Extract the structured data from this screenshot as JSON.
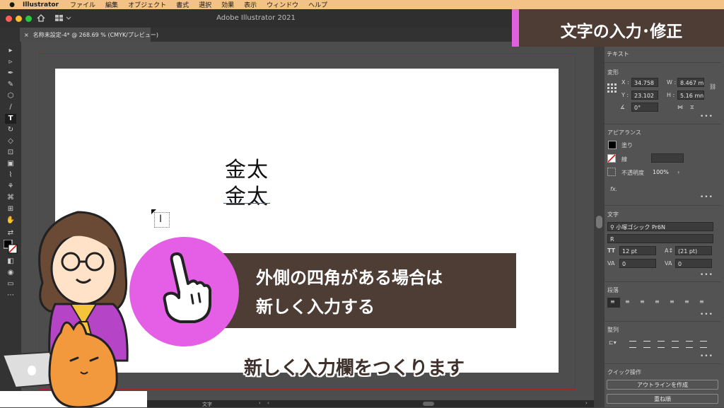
{
  "menubar": {
    "app_name": "Illustrator",
    "items": [
      "ファイル",
      "編集",
      "オブジェクト",
      "書式",
      "選択",
      "効果",
      "表示",
      "ウィンドウ",
      "ヘルプ"
    ]
  },
  "window": {
    "title": "Adobe Illustrator 2021"
  },
  "document_tab": {
    "label": "名称未設定-4* @ 268.69 % (CMYK/プレビュー)",
    "close": "×"
  },
  "artboard": {
    "line1": "金太",
    "line2": "金太"
  },
  "title_banner": {
    "text": "文字の入力･修正",
    "accent_color": "#e060e0",
    "bg_color": "#4d3d35"
  },
  "callout": {
    "line1": "外側の四角がある場合は",
    "line2": "新しく入力する",
    "circle_color": "#e45fe6"
  },
  "subtitle": {
    "text": "新しく入力欄をつくります"
  },
  "right_panel": {
    "panel_title": "テキスト",
    "transform": {
      "header": "変形",
      "x_label": "X :",
      "x_value": "34.758",
      "y_label": "Y :",
      "y_value": "23.102",
      "w_label": "W :",
      "w_value": "8.467 m",
      "h_label": "H :",
      "h_value": "5.16 mn",
      "rotate_value": "0°"
    },
    "appearance": {
      "header": "アピアランス",
      "fill_label": "塗り",
      "stroke_label": "線",
      "opacity_label": "不透明度",
      "opacity_value": "100%",
      "fx_label": "fx."
    },
    "character": {
      "header": "文字",
      "font_family": "小塚ゴシック Pr6N",
      "font_style": "R",
      "font_size": "12 pt",
      "leading": "(21 pt)",
      "kerning": "0",
      "tracking": "0"
    },
    "paragraph": {
      "header": "段落"
    },
    "align": {
      "header": "整列"
    },
    "quick_actions": {
      "header": "クイック操作",
      "outline_button": "アウトラインを作成",
      "arrange_button": "重ね順"
    }
  },
  "bottom_bar": {
    "label": "文字"
  }
}
